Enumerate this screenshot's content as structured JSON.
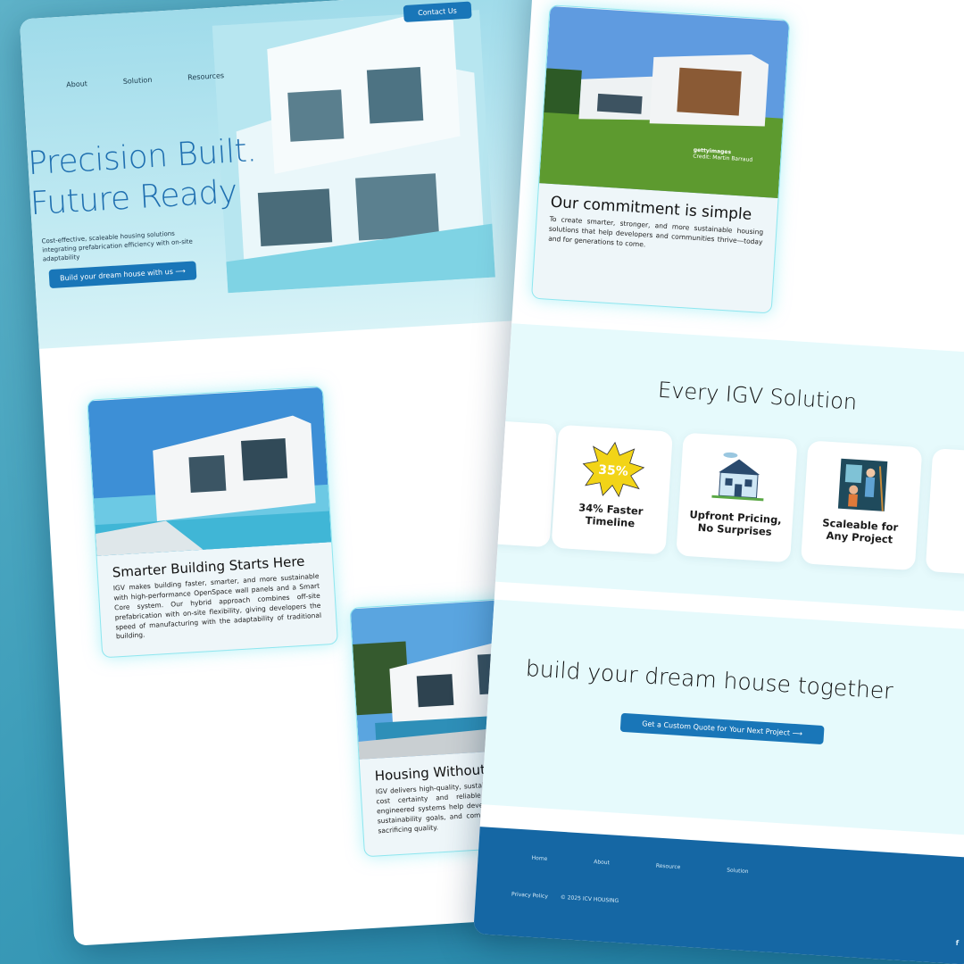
{
  "nav": {
    "items": [
      "About",
      "Solution",
      "Resources"
    ],
    "contact_label": "Contact Us"
  },
  "hero": {
    "title_line1": "Precision Built.",
    "title_line2": "Future Ready",
    "subtitle": "Cost-effective, scaleable housing solutions integrating prefabrication efficiency with on-site adaptability",
    "cta_label": "Build your dream house with us"
  },
  "cards": {
    "smarter": {
      "title": "Smarter Building Starts Here",
      "body": "IGV makes building faster, smarter, and more sustainable with high-performance OpenSpace wall panels and a Smart Core system. Our hybrid approach combines off-site prefabrication with on-site flexibility, giving developers the speed of manufacturing with the adaptability of traditional building."
    },
    "housing": {
      "title": "Housing Without Compromise",
      "body": "IGV delivers high-quality, sustainable building solutions with cost certainty and reliable timelines. Our precision-engineered systems help developers stay on budget, meet sustainability goals, and complete projects faster—without sacrificing quality."
    },
    "commitment": {
      "title": "Our commitment is simple",
      "body": "To create smarter, stronger, and more sustainable housing solutions that help developers and communities thrive—today and for generations to come.",
      "photo_credit_brand": "gettyimages",
      "photo_credit_name": "Credit: Martin Barraud"
    }
  },
  "solutions": {
    "title": "Every IGV Solution",
    "items": [
      {
        "label": "",
        "icon": "partial-card"
      },
      {
        "label": "34% Faster Timeline",
        "icon": "starburst-35-icon",
        "badge": "35%"
      },
      {
        "label": "Upfront Pricing, No Surprises",
        "icon": "house-icon"
      },
      {
        "label": "Scaleable for Any Project",
        "icon": "builders-icon"
      },
      {
        "label": "",
        "icon": "partial-card"
      }
    ]
  },
  "cta": {
    "title": "build your dream house together",
    "button_label": "Get a Custom Quote for Your Next Project"
  },
  "footer": {
    "links": [
      "Home",
      "About",
      "Resource",
      "Solution"
    ],
    "privacy": "Privacy Policy",
    "copyright": "© 2025 ICV HOUSING",
    "social": [
      "facebook-icon",
      "linkedin-icon"
    ]
  },
  "colors": {
    "primary": "#1976b8",
    "hero_title": "#1f6fb0",
    "card_glow": "#8ee6ef",
    "section_bg": "#e6fafc",
    "footer_bg": "#1567a4"
  }
}
